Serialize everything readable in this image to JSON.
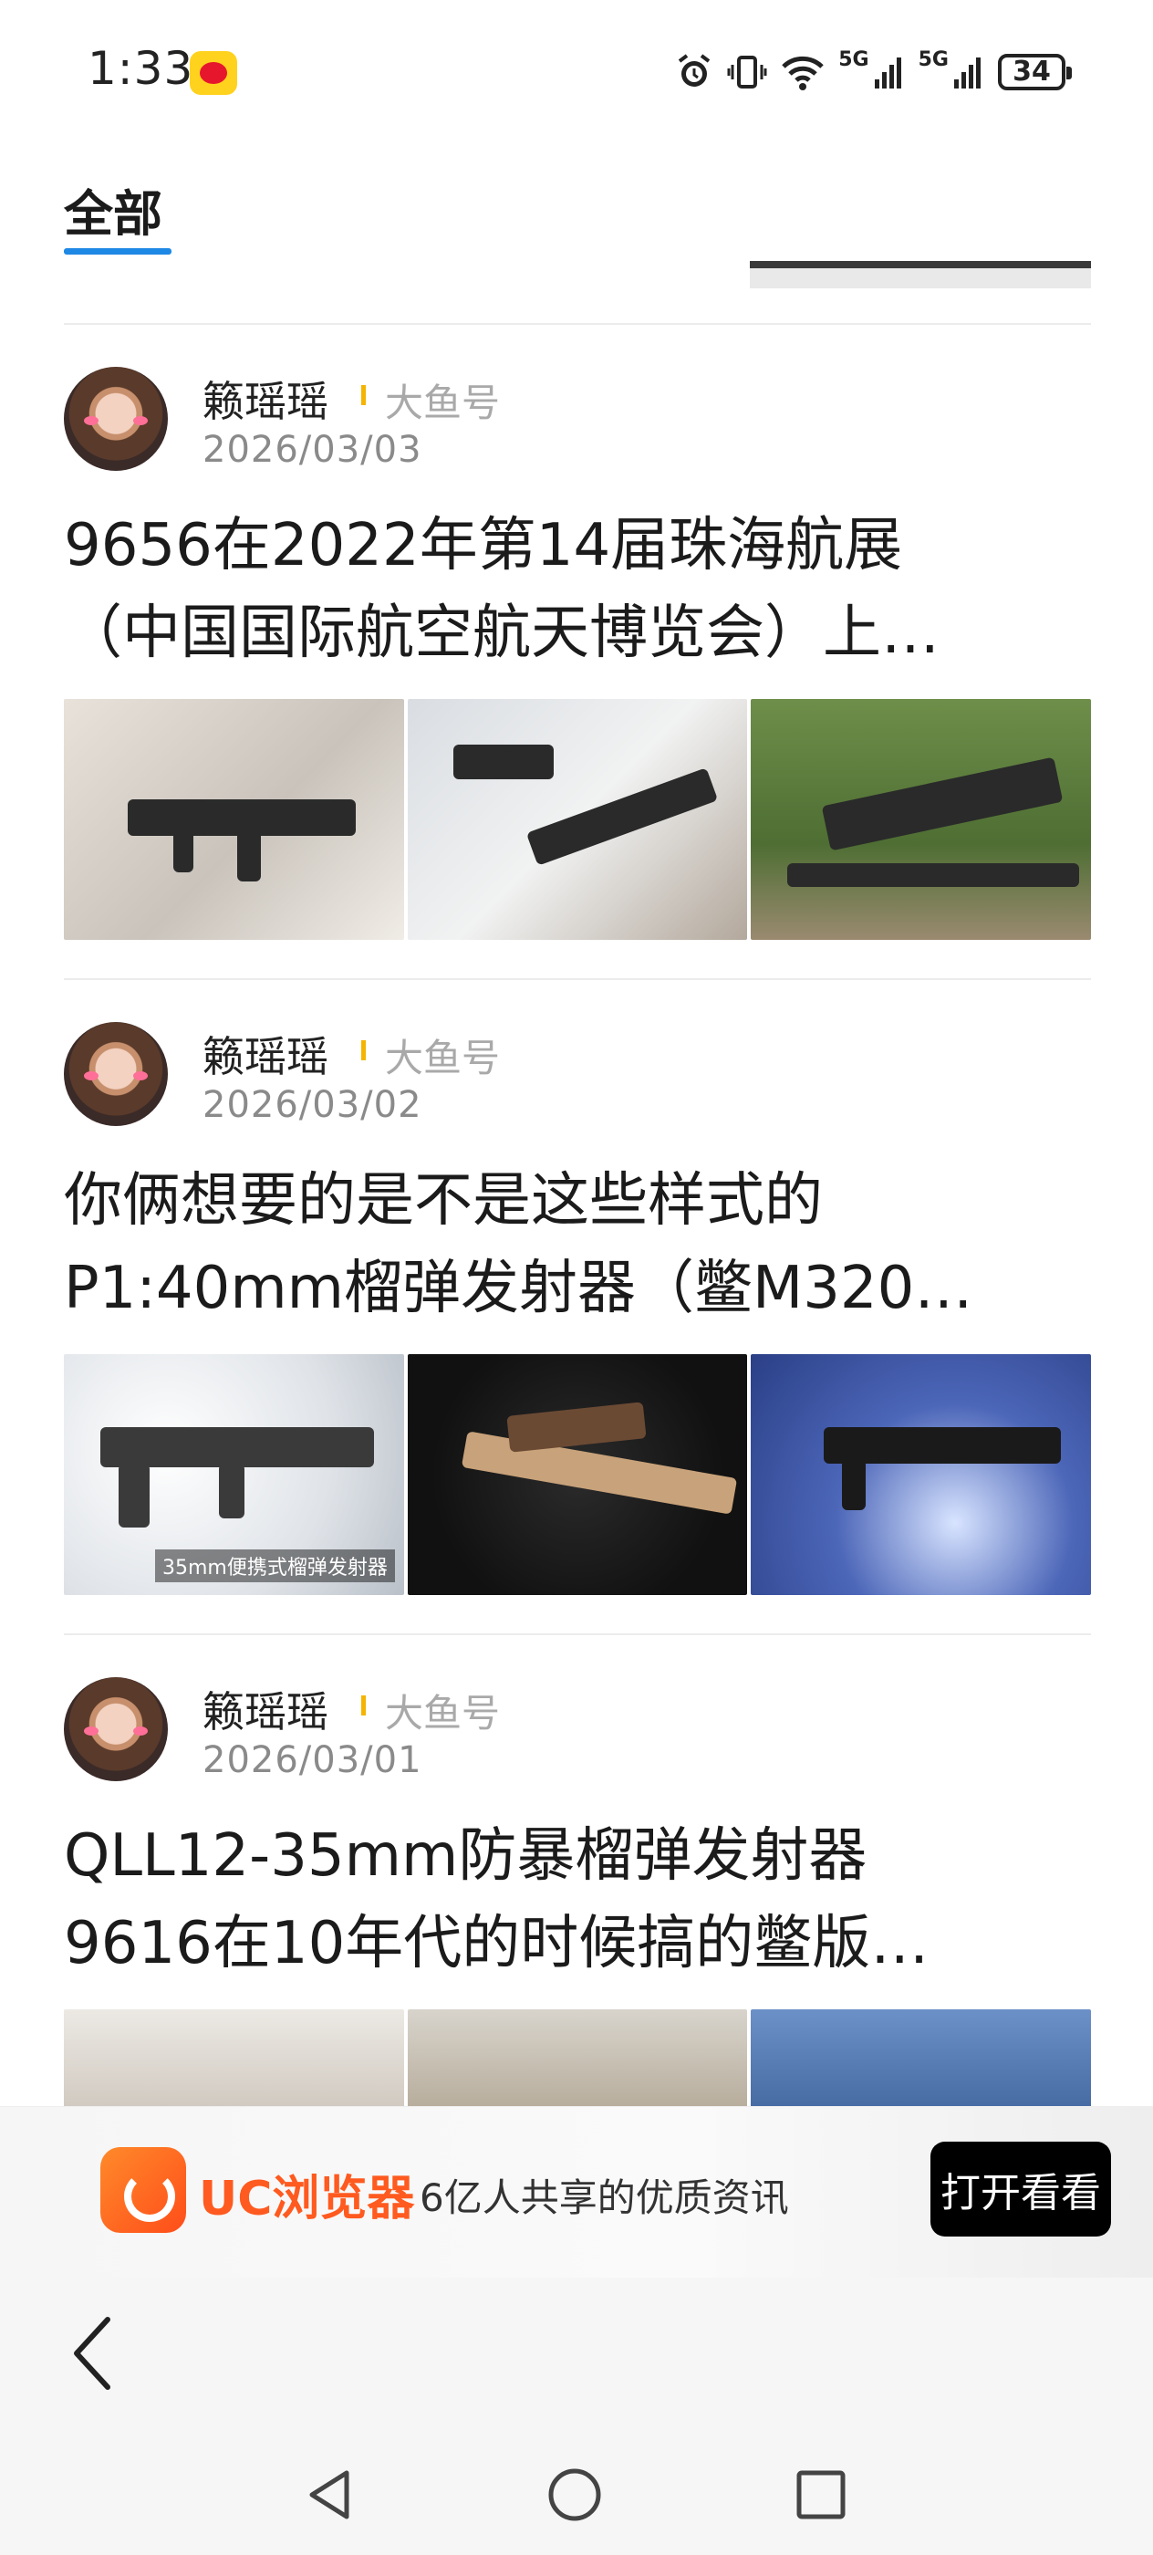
{
  "status_bar": {
    "time": "1:33",
    "network1": "5G",
    "network2": "5G",
    "battery": "34"
  },
  "tabs": {
    "active": "全部"
  },
  "articles": [
    {
      "author": "籁瑶瑶",
      "source": "大鱼号",
      "date": "2026/03/03",
      "title_line1": "9656在2022年第14届珠海航展",
      "title_line2": "（中国国际航空航天博览会）上…"
    },
    {
      "author": "籁瑶瑶",
      "source": "大鱼号",
      "date": "2026/03/02",
      "title_line1": "你俩想要的是不是这些样式的",
      "title_line2": "P1:40mm榴弹发射器（鳖M320…",
      "image_caption": "35mm便携式榴弹发射器"
    },
    {
      "author": "籁瑶瑶",
      "source": "大鱼号",
      "date": "2026/03/01",
      "title_line1": "QLL12-35mm防暴榴弹发射器",
      "title_line2": "9616在10年代的时候搞的鳖版…"
    }
  ],
  "banner": {
    "app_name": "UC浏览器",
    "slogan": "6亿人共享的优质资讯",
    "button": "打开看看"
  }
}
